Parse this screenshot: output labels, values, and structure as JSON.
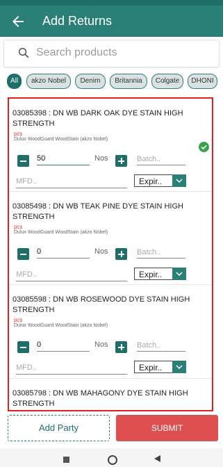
{
  "header": {
    "title": "Add Returns"
  },
  "search": {
    "placeholder": "Search products"
  },
  "filters": [
    "All",
    "akzo Nobel",
    "Denim",
    "Britannia",
    "Colgate",
    "DHONI"
  ],
  "products": [
    {
      "title": "03085398 : DN WB DARK OAK DYE STAIN HIGH STRENGTH",
      "uom": "pcs",
      "brand": "Dulux WoodGuard WoodStain (akzo Nobel)",
      "qty": "50",
      "unit": "Nos",
      "batch_placeholder": "Batch..",
      "mfd_placeholder": "MFD..",
      "expiry": "Expir..",
      "selected": true
    },
    {
      "title": "03085498 : DN WB TEAK PINE DYE STAIN HIGH STRENGTH",
      "uom": "pcs",
      "brand": "Dulux WoodGuard WoodStain (akzo Nobel)",
      "qty": "0",
      "unit": "Nos",
      "batch_placeholder": "Batch..",
      "mfd_placeholder": "MFD..",
      "expiry": "Expir..",
      "selected": false
    },
    {
      "title": "03085598 : DN WB ROSEWOOD DYE STAIN HIGH STRENGTH",
      "uom": "pcs",
      "brand": "Dulux WoodGuard WoodStain (akzo Nobel)",
      "qty": "0",
      "unit": "Nos",
      "batch_placeholder": "Batch..",
      "mfd_placeholder": "MFD..",
      "expiry": "Expir..",
      "selected": false
    },
    {
      "title": "03085798 : DN WB MAHAGONY DYE STAIN HIGH STRENGTH",
      "uom": "",
      "brand": "",
      "qty": "",
      "unit": "",
      "batch_placeholder": "",
      "mfd_placeholder": "",
      "expiry": "",
      "selected": false
    }
  ],
  "footer": {
    "add_party": "Add Party",
    "submit": "SUBMIT"
  },
  "colors": {
    "primary": "#2a7f77",
    "dark": "#1f6f68",
    "submit": "#de5050",
    "highlight": "#e01f22",
    "check": "#3aa34a"
  }
}
